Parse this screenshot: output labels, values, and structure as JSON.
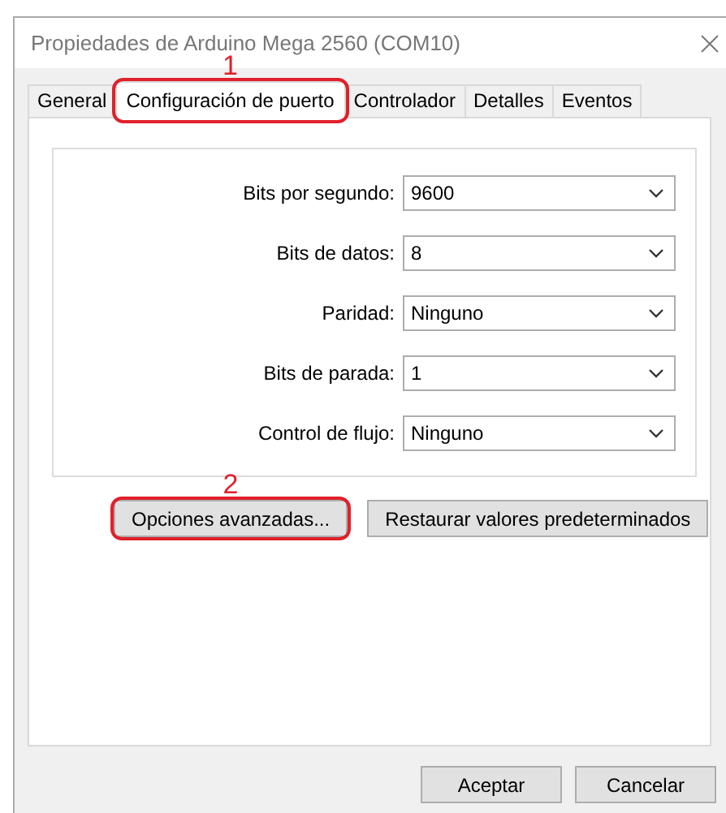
{
  "window": {
    "title": "Propiedades de Arduino Mega 2560 (COM10)"
  },
  "tabs": [
    {
      "label": "General",
      "selected": false
    },
    {
      "label": "Configuración de puerto",
      "selected": true,
      "callout": "1"
    },
    {
      "label": "Controlador",
      "selected": false
    },
    {
      "label": "Detalles",
      "selected": false
    },
    {
      "label": "Eventos",
      "selected": false
    }
  ],
  "settings": [
    {
      "label": "Bits por segundo:",
      "value": "9600"
    },
    {
      "label": "Bits de datos:",
      "value": "8"
    },
    {
      "label": "Paridad:",
      "value": "Ninguno"
    },
    {
      "label": "Bits de parada:",
      "value": "1"
    },
    {
      "label": "Control de flujo:",
      "value": "Ninguno"
    }
  ],
  "panel_buttons": [
    {
      "label": "Opciones avanzadas...",
      "callout": "2"
    },
    {
      "label": "Restaurar valores predeterminados"
    }
  ],
  "dialog_buttons": [
    "Aceptar",
    "Cancelar"
  ]
}
